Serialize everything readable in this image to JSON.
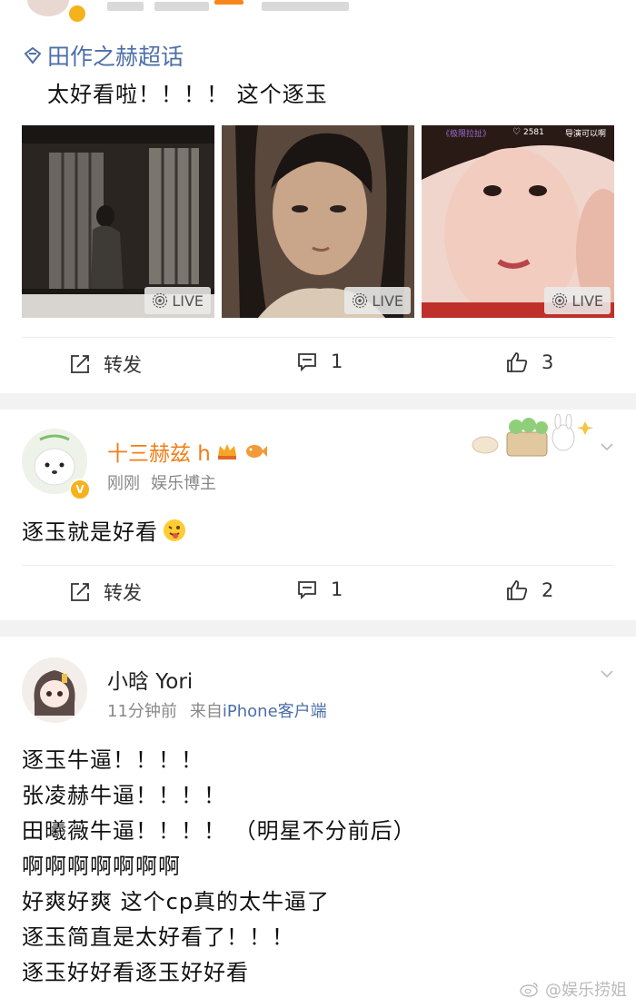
{
  "post1": {
    "topic": "田作之赫超话",
    "text": "太好看啦！！！！ 这个逐玉",
    "media": [
      {
        "live": "LIVE"
      },
      {
        "live": "LIVE"
      },
      {
        "live": "LIVE",
        "overlay_left": "《极限拉扯》",
        "overlay_count": "2581",
        "overlay_right": "导演可以啊"
      }
    ],
    "actions": {
      "repost": "转发",
      "comments": "1",
      "likes": "3"
    }
  },
  "post2": {
    "username": "十三赫兹 h",
    "time": "刚刚",
    "tag": "娱乐博主",
    "text": "逐玉就是好看",
    "emoji": "😜",
    "actions": {
      "repost": "转发",
      "comments": "1",
      "likes": "2"
    }
  },
  "post3": {
    "username": "小晗 Yori",
    "time": "11分钟前",
    "source_prefix": "来自",
    "source_device": "iPhone",
    "source_suffix": "客户端",
    "lines": [
      "逐玉牛逼！！！！",
      "张凌赫牛逼！！！！",
      "田曦薇牛逼！！！！ （明星不分前后）",
      "啊啊啊啊啊啊啊",
      "好爽好爽 这个cp真的太牛逼了",
      "逐玉简直是太好看了！！！",
      "逐玉好好看逐玉好好看"
    ]
  },
  "watermark": "@娱乐捞姐",
  "colors": {
    "link_blue": "#4d6fa8",
    "name_orange": "#f07f17",
    "badge_gold": "#f5b21b",
    "separator": "#f2f2f2"
  }
}
